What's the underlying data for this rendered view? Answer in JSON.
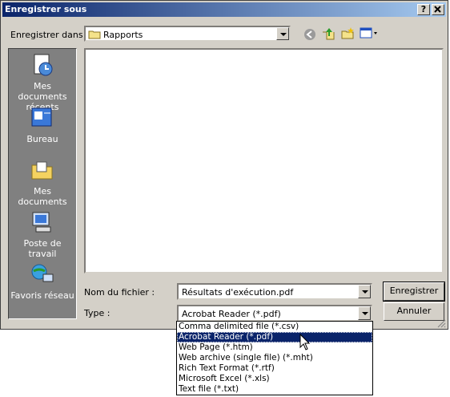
{
  "window": {
    "title": "Enregistrer sous",
    "help_btn": "?",
    "close_btn": "X"
  },
  "toolbar": {
    "save_in_label": "Enregistrer dans :",
    "save_in_value": "Rapports",
    "icons": [
      "back-icon",
      "up-folder-icon",
      "new-folder-icon",
      "view-menu-icon"
    ]
  },
  "places": [
    {
      "label": "Mes documents récents",
      "icon": "recent-documents-icon"
    },
    {
      "label": "Bureau",
      "icon": "desktop-icon"
    },
    {
      "label": "Mes documents",
      "icon": "my-documents-icon"
    },
    {
      "label": "Poste de travail",
      "icon": "my-computer-icon"
    },
    {
      "label": "Favoris réseau",
      "icon": "network-places-icon"
    }
  ],
  "filename": {
    "label": "Nom du fichier :",
    "value": "Résultats d'exécution.pdf"
  },
  "filetype": {
    "label": "Type :",
    "value": "Acrobat Reader (*.pdf)",
    "options": [
      "Comma delimited file (*.csv)",
      "Acrobat Reader (*.pdf)",
      "Web Page (*.htm)",
      "Web archive (single file) (*.mht)",
      "Rich Text Format (*.rtf)",
      "Microsoft Excel (*.xls)",
      "Text file (*.txt)"
    ],
    "selected_index": 1
  },
  "buttons": {
    "save": "Enregistrer",
    "cancel": "Annuler"
  },
  "colors": {
    "title_start": "#0a246a",
    "title_end": "#a6caf0",
    "face": "#d4d0c8",
    "places_bg": "#808080",
    "selection": "#0a246a"
  }
}
